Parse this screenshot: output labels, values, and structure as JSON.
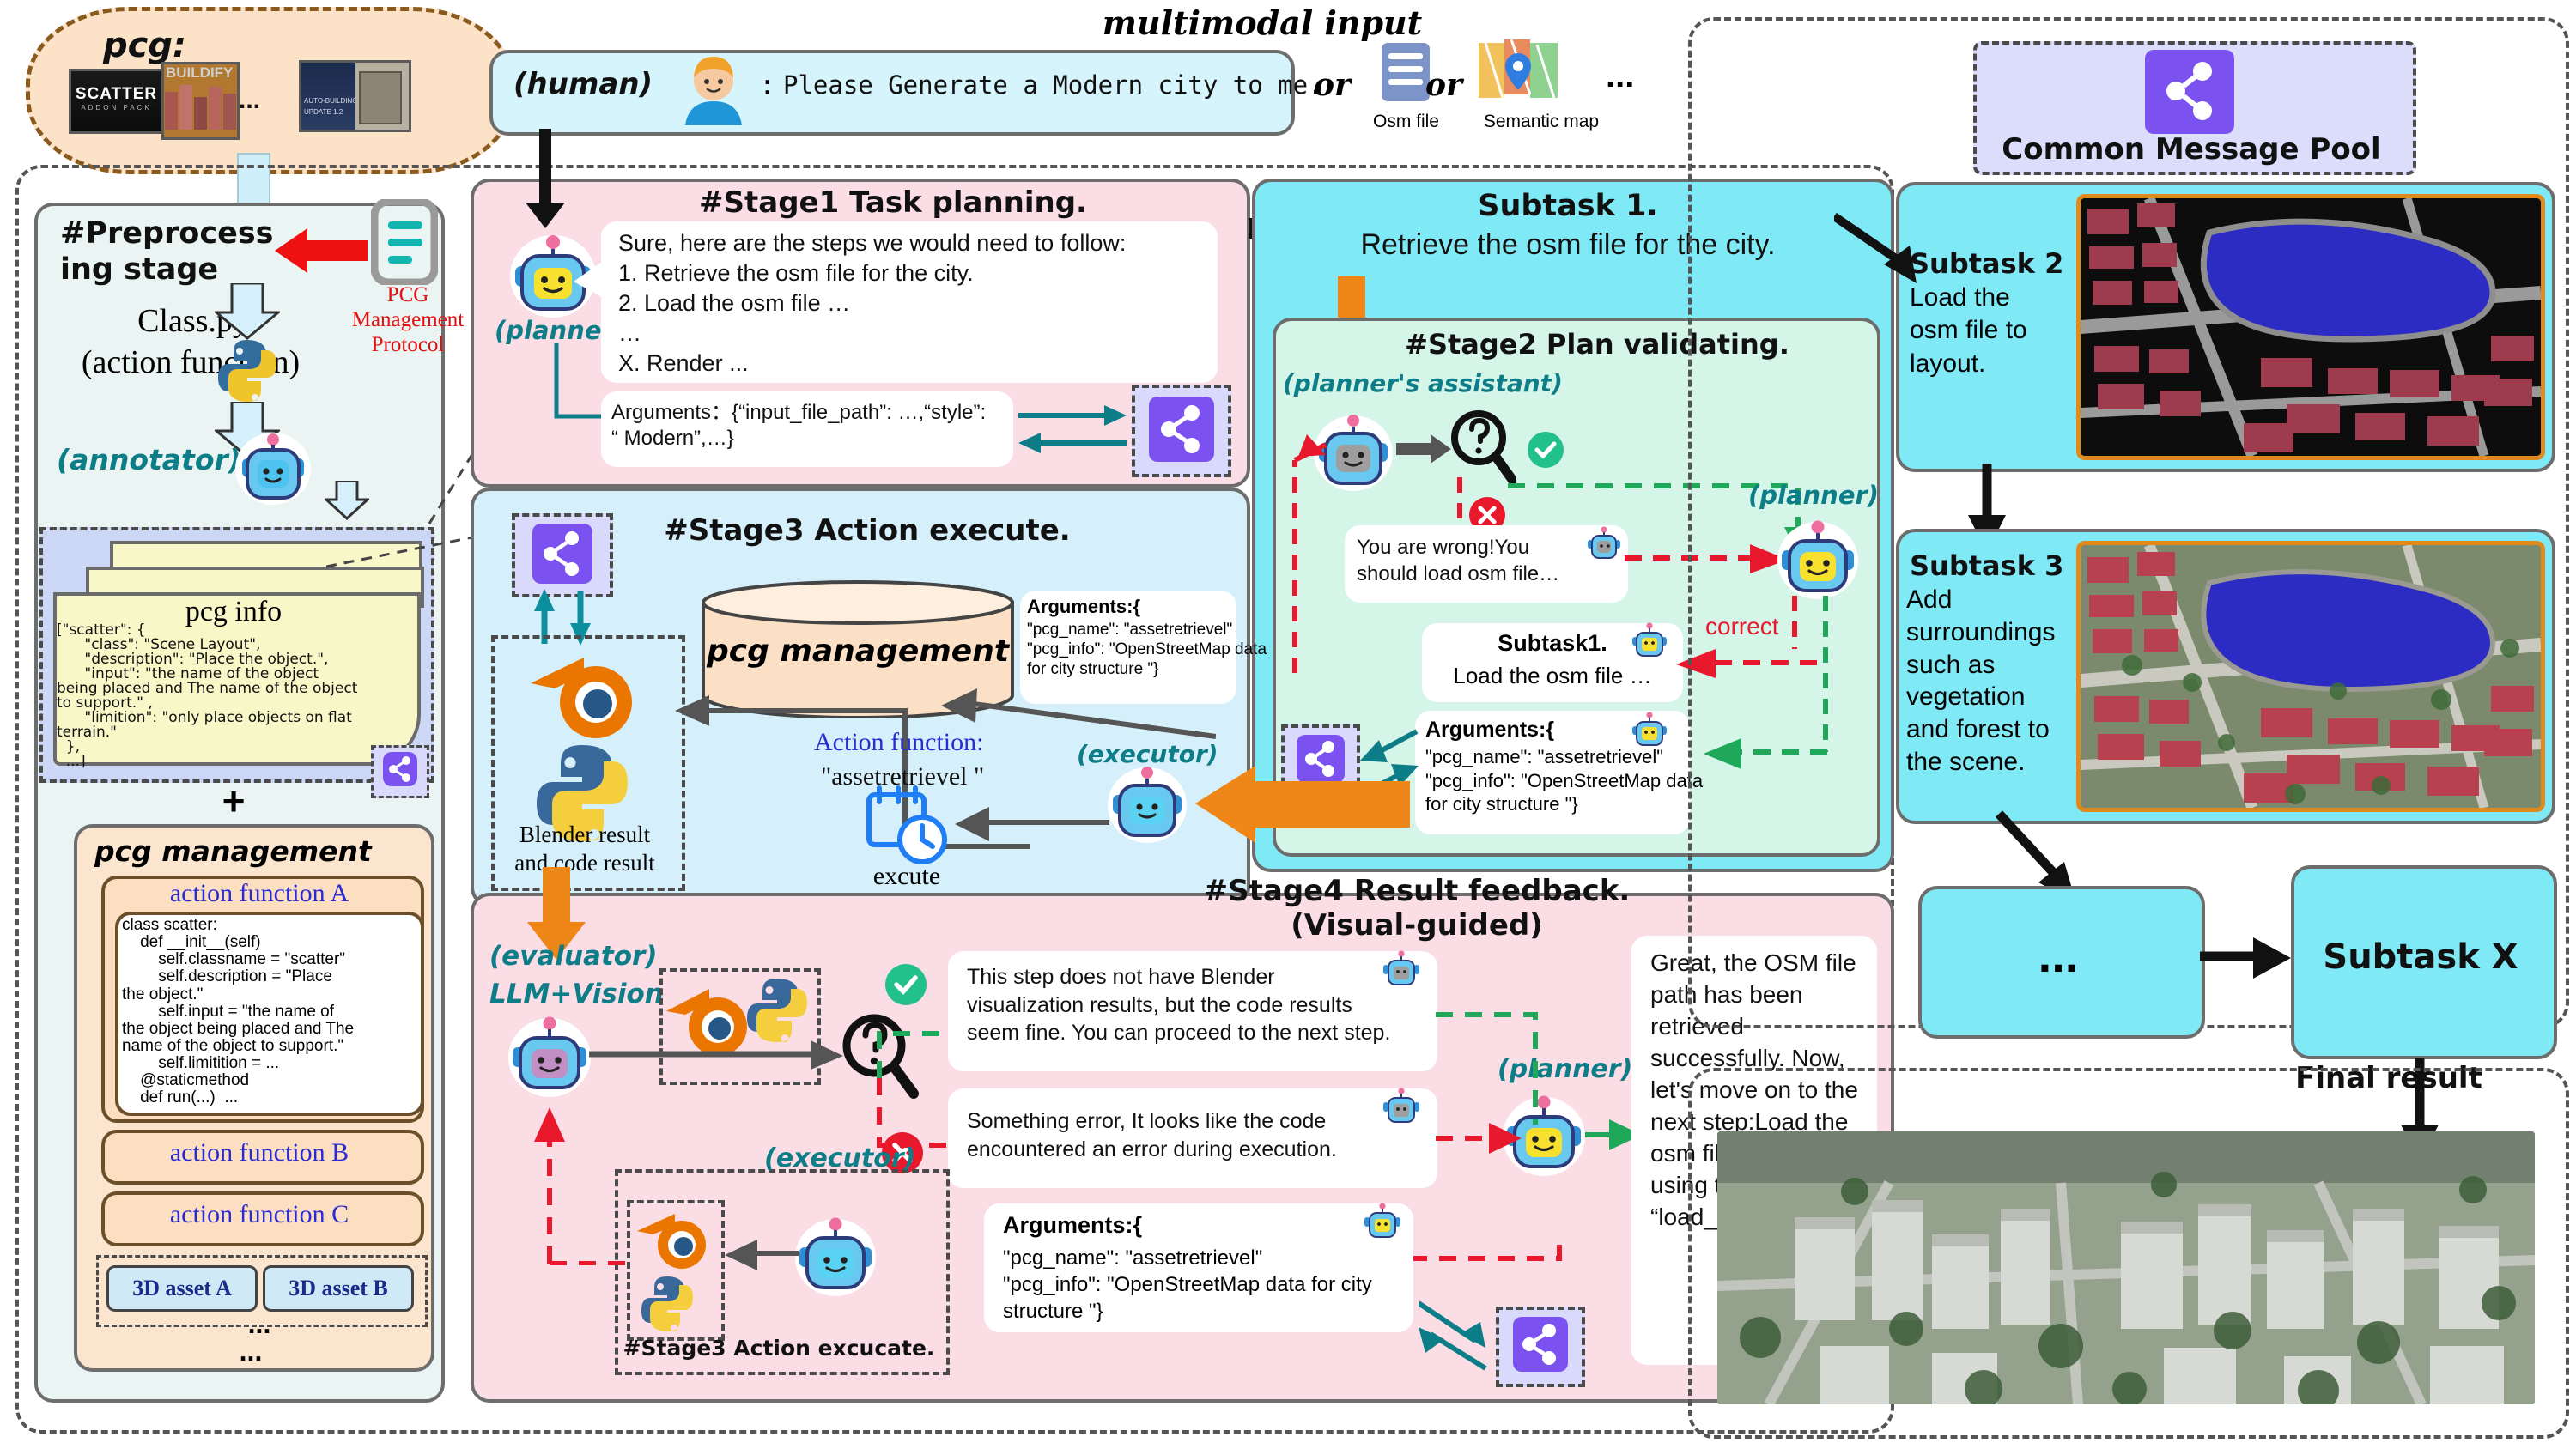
{
  "title_top": "multimodal input",
  "cloud": {
    "label": "pcg:",
    "thumbs": [
      "SCATTER ADDON PACK",
      "BUILDIFY",
      "AUTO-BUILDING UPDATE 1.2"
    ],
    "ellipsis": "..."
  },
  "human_prompt": {
    "speaker": "(human)",
    "colon": ":",
    "text": "Please Generate a Modern city to me."
  },
  "input_options": {
    "or1": "or",
    "or2": "or",
    "osm_label": "Osm file",
    "semantic_label": "Semantic map",
    "ellipsis": "..."
  },
  "preprocess": {
    "title_line1": "#Preprocess",
    "title_line2": "ing stage",
    "class_py": "Class.py",
    "action_function": "(action function)",
    "protocol_line1": "PCG",
    "protocol_line2": "Management",
    "protocol_line3": "Protocol",
    "annotator": "(annotator)",
    "pcg_info_title": "pcg info",
    "pcg_info_body": "[\"scatter\": {\n      \"class\": \"Scene Layout\",\n      \"description\": \"Place the object.\",\n      \"input\": \"the name of the object\nbeing placed and The name of the object\nto support.\" ,\n      \"limition\": \"only place objects on flat\nterrain.\"\n  },\n  ...]",
    "plus": "+",
    "pcg_management_title": "pcg management",
    "action_function_a": "action function A",
    "code_body": "class scatter:\n    def __init__(self)\n        self.classname = \"scatter\"\n        self.description = \"Place\nthe object.\"\n        self.input = \"the name of\nthe object being placed and The\nname of the object to support.\"\n        self.limitition = ...\n    @staticmethod\n    def run(...)  ...",
    "action_function_b": "action function B",
    "action_function_c": "action function C",
    "asset_a": "3D asset A",
    "asset_b": "3D asset B",
    "assets_ellipsis": "...",
    "bottom_ellipsis": "..."
  },
  "stage1": {
    "title": "#Stage1 Task planning.",
    "planner": "(planner)",
    "plan_lines": [
      "Sure, here are the steps we would need to follow:",
      "1. Retrieve the osm file for the city.",
      "2. Load the osm file …",
      "…",
      "X. Render ..."
    ],
    "arguments": "Arguments：{“input_file_path”: …,“style”:\n“ Modern”,…}"
  },
  "subtask1": {
    "heading": "Subtask 1.",
    "text": "Retrieve the osm file for the city."
  },
  "stage2": {
    "title": "#Stage2 Plan validating.",
    "assistant_label": "(planner's assistant)",
    "planner_label": "(planner)",
    "wrong_msg": "You are wrong!You\nshould load osm file…",
    "subtask_heading": "Subtask1.",
    "subtask_text": "Load the osm file …",
    "correct_label": "correct",
    "arguments_title": "Arguments:{",
    "arguments_body": "\"pcg_name\": \"assetretrievel\"\n\"pcg_info\": \"OpenStreetMap data\nfor city structure \"}"
  },
  "stage3": {
    "title": "#Stage3 Action execute.",
    "db_label": "pcg management",
    "blender_label": "Blender result\nand code result",
    "action_function_label": "Action function:",
    "action_function_value": "\"assetretrievel \"",
    "executor_label": "(executor)",
    "execute_label": "excute",
    "arguments_title": "Arguments:{",
    "arguments_body": "\"pcg_name\": \"assetretrievel\"\n\"pcg_info\": \"OpenStreetMap data\nfor city structure \"}"
  },
  "stage4": {
    "title_line1": "#Stage4 Result feedback.",
    "title_line2": "(Visual-guided)",
    "evaluator_label": "(evaluator)",
    "evaluator_sub": "LLM+Vision",
    "ok_msg": "This step does not have Blender\nvisualization results, but the code results\nseem fine. You can proceed to the next step.",
    "err_msg": "Something error, It looks like the code\nencountered an error during execution.",
    "planner_label": "(planner)",
    "executor_label": "(executor)",
    "stage3_again": "#Stage3 Action excucate.",
    "arguments_title": "Arguments:{",
    "arguments_body": "\"pcg_name\": \"assetretrievel\"\n\"pcg_info\": \"OpenStreetMap data for city\nstructure \"}",
    "planner_msg": "Great, the OSM file path has been retrieved successfully. Now, let's move on to the next step:Load the osm file to layout using the “load_osm_file_to_layout”function."
  },
  "right": {
    "pool_label": "Common Message Pool",
    "subtask2_heading": "Subtask 2",
    "subtask2_text": "Load the\nosm file to\nlayout.",
    "subtask3_heading": "Subtask 3",
    "subtask3_text": "Add\nsurroundings\nsuch as\nvegetation\nand forest to\nthe scene.",
    "ellipsis_box": "...",
    "subtaskx": "Subtask X",
    "final_result": "Final result"
  },
  "colors": {
    "cyan": "#7fe9f5",
    "pink": "#fbdde6",
    "lightblue": "#d6f0fb",
    "mint": "#d5f5e8",
    "orange": "#ef8618",
    "purple": "#7b52f0",
    "teal": "#0d7d87",
    "green": "#17a34a",
    "red": "#e8192c"
  }
}
